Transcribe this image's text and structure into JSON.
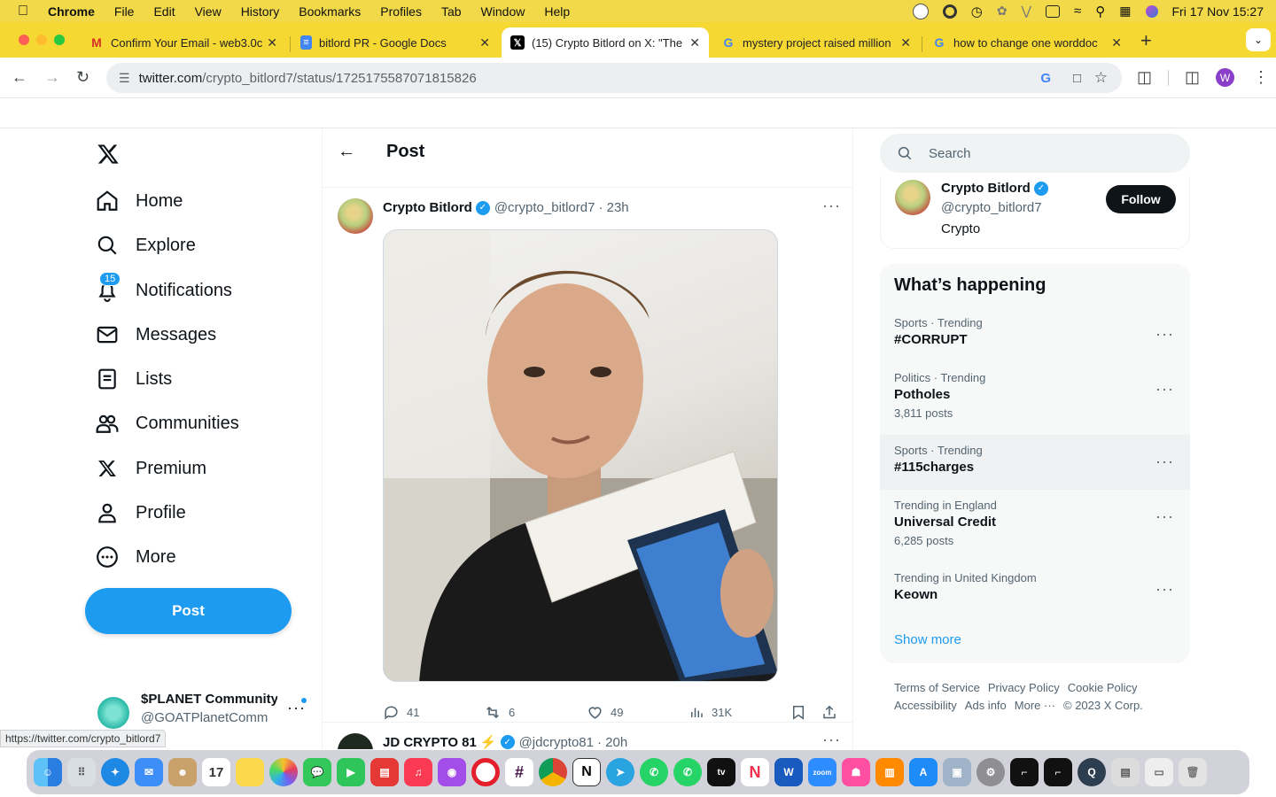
{
  "menubar": {
    "app": "Chrome",
    "items": [
      "File",
      "Edit",
      "View",
      "History",
      "Bookmarks",
      "Profiles",
      "Tab",
      "Window",
      "Help"
    ],
    "clock": "Fri 17 Nov  15:27"
  },
  "tabs": [
    {
      "title": "Confirm Your Email - web3.0c",
      "favicon": "gmail-icon"
    },
    {
      "title": "bitlord PR - Google Docs",
      "favicon": "docs-icon"
    },
    {
      "title": "(15) Crypto Bitlord on X: \"The",
      "favicon": "x-icon",
      "active": true
    },
    {
      "title": "mystery project raised million",
      "favicon": "google-icon"
    },
    {
      "title": "how to change one worddoc",
      "favicon": "google-icon"
    }
  ],
  "address": {
    "host": "twitter.com",
    "path": "/crypto_bitlord7/status/1725175587071815826"
  },
  "profile_initial": "W",
  "nav": {
    "items": [
      {
        "label": "Home",
        "icon": "home-icon"
      },
      {
        "label": "Explore",
        "icon": "search-icon"
      },
      {
        "label": "Notifications",
        "icon": "bell-icon",
        "badge": "15"
      },
      {
        "label": "Messages",
        "icon": "mail-icon"
      },
      {
        "label": "Lists",
        "icon": "list-icon"
      },
      {
        "label": "Communities",
        "icon": "communities-icon"
      },
      {
        "label": "Premium",
        "icon": "x-icon"
      },
      {
        "label": "Profile",
        "icon": "person-icon"
      },
      {
        "label": "More",
        "icon": "more-circle-icon"
      }
    ],
    "post_button": "Post",
    "account": {
      "name": "$PLANET Community",
      "handle": "@GOATPlanetComm"
    }
  },
  "header": {
    "title": "Post"
  },
  "tweet": {
    "name": "Crypto Bitlord",
    "handle": "@crypto_bitlord7",
    "time": "· 23h",
    "replies": "41",
    "retweets": "6",
    "likes": "49",
    "views": "31K"
  },
  "next_tweet": {
    "name": "JD CRYPTO 81",
    "handle": "@jdcrypto81",
    "time": "· 20h"
  },
  "search": {
    "placeholder": "Search"
  },
  "profile_card": {
    "name": "Crypto Bitlord",
    "handle": "@crypto_bitlord7",
    "bio": "Crypto",
    "follow": "Follow"
  },
  "happening": {
    "title": "What’s happening",
    "trends": [
      {
        "category": "Sports · Trending",
        "name": "#CORRUPT",
        "count": ""
      },
      {
        "category": "Politics · Trending",
        "name": "Potholes",
        "count": "3,811 posts"
      },
      {
        "category": "Sports · Trending",
        "name": "#115charges",
        "count": ""
      },
      {
        "category": "Trending in England",
        "name": "Universal Credit",
        "count": "6,285 posts"
      },
      {
        "category": "Trending in United Kingdom",
        "name": "Keown",
        "count": ""
      }
    ],
    "show_more": "Show more"
  },
  "footer": {
    "links": [
      "Terms of Service",
      "Privacy Policy",
      "Cookie Policy",
      "Accessibility",
      "Ads info",
      "More ···"
    ],
    "copyright": "© 2023 X Corp."
  },
  "status_url": "https://twitter.com/crypto_bitlord7",
  "colors": {
    "accent": "#1d9bf0",
    "tabbar": "#f6d832",
    "menubar": "#f1d94a"
  }
}
